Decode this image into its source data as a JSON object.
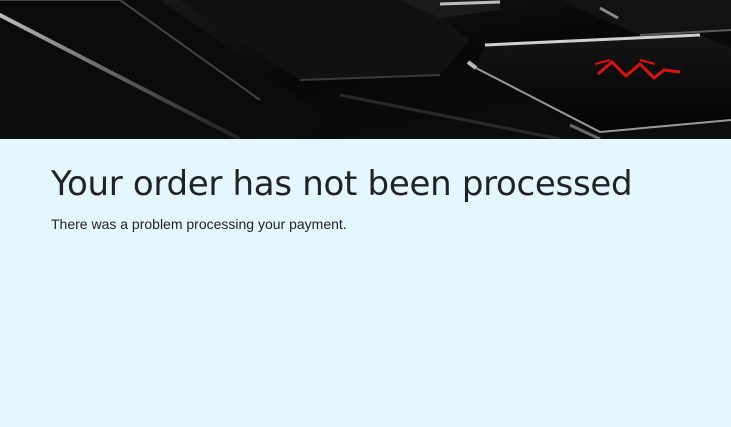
{
  "hero": {
    "image": "keyboard-keys-photo",
    "key_letter": "M",
    "accent_color": "#e01010"
  },
  "main": {
    "title": "Your order has not been processed",
    "message": "There was a problem processing your payment."
  },
  "colors": {
    "background": "#e4f7ff",
    "text": "#222222"
  }
}
